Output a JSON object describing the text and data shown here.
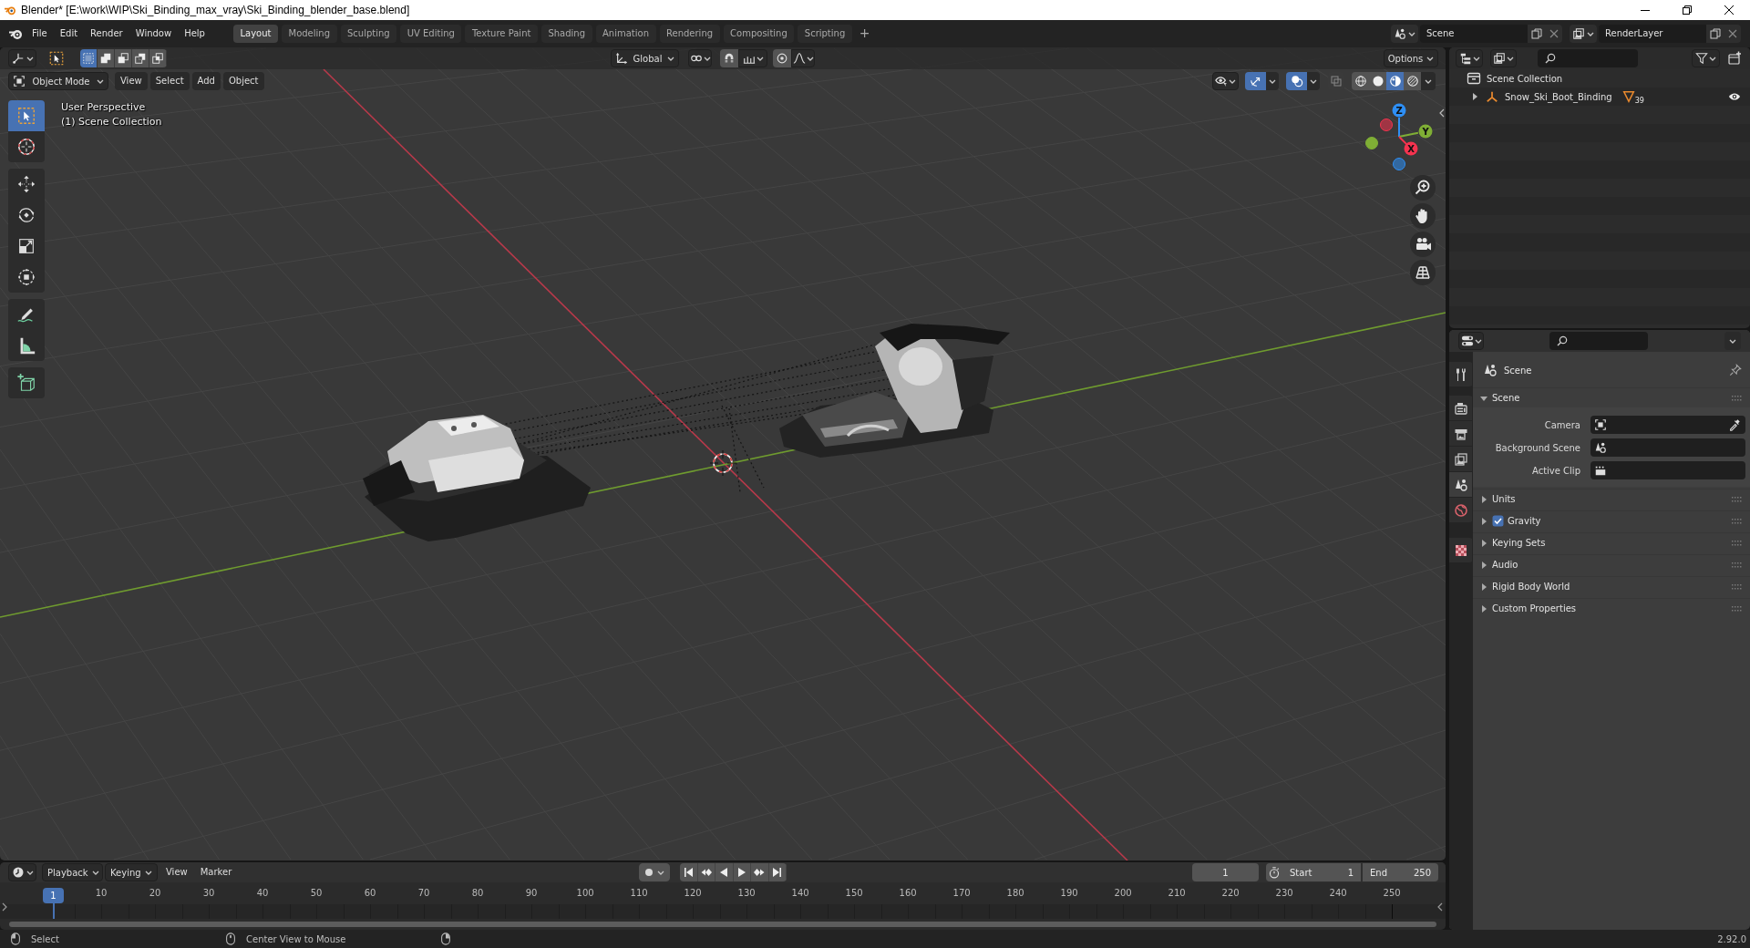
{
  "window": {
    "title": "Blender* [E:\\work\\WIP\\Ski_Binding_max_vray\\Ski_Binding_blender_base.blend]"
  },
  "top_bar": {
    "menus": [
      "File",
      "Edit",
      "Render",
      "Window",
      "Help"
    ],
    "workspaces": [
      {
        "label": "Layout",
        "selected": true
      },
      {
        "label": "Modeling",
        "selected": false
      },
      {
        "label": "Sculpting",
        "selected": false
      },
      {
        "label": "UV Editing",
        "selected": false
      },
      {
        "label": "Texture Paint",
        "selected": false
      },
      {
        "label": "Shading",
        "selected": false
      },
      {
        "label": "Animation",
        "selected": false
      },
      {
        "label": "Rendering",
        "selected": false
      },
      {
        "label": "Compositing",
        "selected": false
      },
      {
        "label": "Scripting",
        "selected": false
      }
    ],
    "add_workspace": "+",
    "scene": "Scene",
    "view_layer": "RenderLayer"
  },
  "viewport": {
    "tool_header": {
      "select_modes": [
        {
          "kind": "set",
          "selected": true
        },
        {
          "kind": "extend",
          "selected": false
        },
        {
          "kind": "subtract",
          "selected": false
        },
        {
          "kind": "invert",
          "selected": false
        },
        {
          "kind": "intersect",
          "selected": false
        }
      ],
      "orientation": "Global",
      "snap": false,
      "proportional": false,
      "options": "Options"
    },
    "header": {
      "mode": "Object Mode",
      "menus": [
        "View",
        "Select",
        "Add",
        "Object"
      ],
      "gizmos": true,
      "overlays": true,
      "xray": false,
      "shading": [
        {
          "kind": "wireframe",
          "selected": false
        },
        {
          "kind": "solid",
          "selected": false
        },
        {
          "kind": "material",
          "selected": true
        },
        {
          "kind": "rendered",
          "selected": false
        }
      ]
    },
    "info": [
      "User Perspective",
      "(1) Scene Collection"
    ],
    "tool_groups": [
      [
        {
          "kind": "select",
          "selected": true
        },
        {
          "kind": "cursor",
          "selected": false
        }
      ],
      [
        {
          "kind": "move",
          "selected": false
        },
        {
          "kind": "rotate",
          "selected": false
        },
        {
          "kind": "scale",
          "selected": false
        },
        {
          "kind": "transform",
          "selected": false
        }
      ],
      [
        {
          "kind": "annotate",
          "selected": false
        },
        {
          "kind": "measure",
          "selected": false
        }
      ],
      [
        {
          "kind": "add_cube",
          "selected": false
        }
      ]
    ],
    "axes": [
      {
        "label": "Z",
        "color": "#2e8ff5"
      },
      {
        "label": "Y",
        "color": "#7fae35"
      },
      {
        "label": "X",
        "color": "#f5334f"
      }
    ]
  },
  "outliner": {
    "items": [
      {
        "label": "Scene Collection",
        "children": [
          {
            "label": "Snow_Ski_Boot_Binding",
            "expanded": false,
            "count": "39",
            "visible": true
          }
        ]
      }
    ]
  },
  "properties": {
    "tab_groups": [
      [
        {
          "kind": "tool",
          "selected": false
        }
      ],
      [
        {
          "kind": "render",
          "selected": false
        },
        {
          "kind": "output",
          "selected": false
        },
        {
          "kind": "view_layer",
          "selected": false
        },
        {
          "kind": "scene",
          "selected": true
        },
        {
          "kind": "world",
          "selected": false
        }
      ],
      [
        {
          "kind": "texture",
          "selected": false
        }
      ]
    ],
    "context": "Scene",
    "panels": [
      {
        "title": "Scene",
        "expanded": true,
        "fields": [
          {
            "label": "Camera",
            "kind": "camera"
          },
          {
            "label": "Background Scene",
            "kind": "scene"
          },
          {
            "label": "Active Clip",
            "kind": "clip"
          }
        ]
      },
      {
        "title": "Units",
        "expanded": false
      },
      {
        "title": "Gravity",
        "expanded": false,
        "checked": true
      },
      {
        "title": "Keying Sets",
        "expanded": false
      },
      {
        "title": "Audio",
        "expanded": false
      },
      {
        "title": "Rigid Body World",
        "expanded": false
      },
      {
        "title": "Custom Properties",
        "expanded": false
      }
    ]
  },
  "timeline": {
    "menus": [
      {
        "label": "Playback",
        "kind": "dropdown"
      },
      {
        "label": "Keying",
        "kind": "dropdown"
      },
      {
        "label": "View",
        "kind": "menu"
      },
      {
        "label": "Marker",
        "kind": "menu"
      }
    ],
    "auto_keying": false,
    "current_frame": "1",
    "start_label": "Start",
    "start": "1",
    "end_label": "End",
    "end": "250",
    "playhead": "1",
    "ruler": [
      "10",
      "20",
      "30",
      "40",
      "50",
      "60",
      "70",
      "80",
      "90",
      "100",
      "110",
      "120",
      "130",
      "140",
      "150",
      "160",
      "170",
      "180",
      "190",
      "200",
      "210",
      "220",
      "230",
      "240",
      "250"
    ]
  },
  "status_bar": {
    "hints": [
      {
        "kind": "left",
        "label": "Select"
      },
      {
        "kind": "middle",
        "label": "Center View to Mouse"
      },
      {
        "kind": "right"
      }
    ],
    "version": "2.92.0"
  }
}
